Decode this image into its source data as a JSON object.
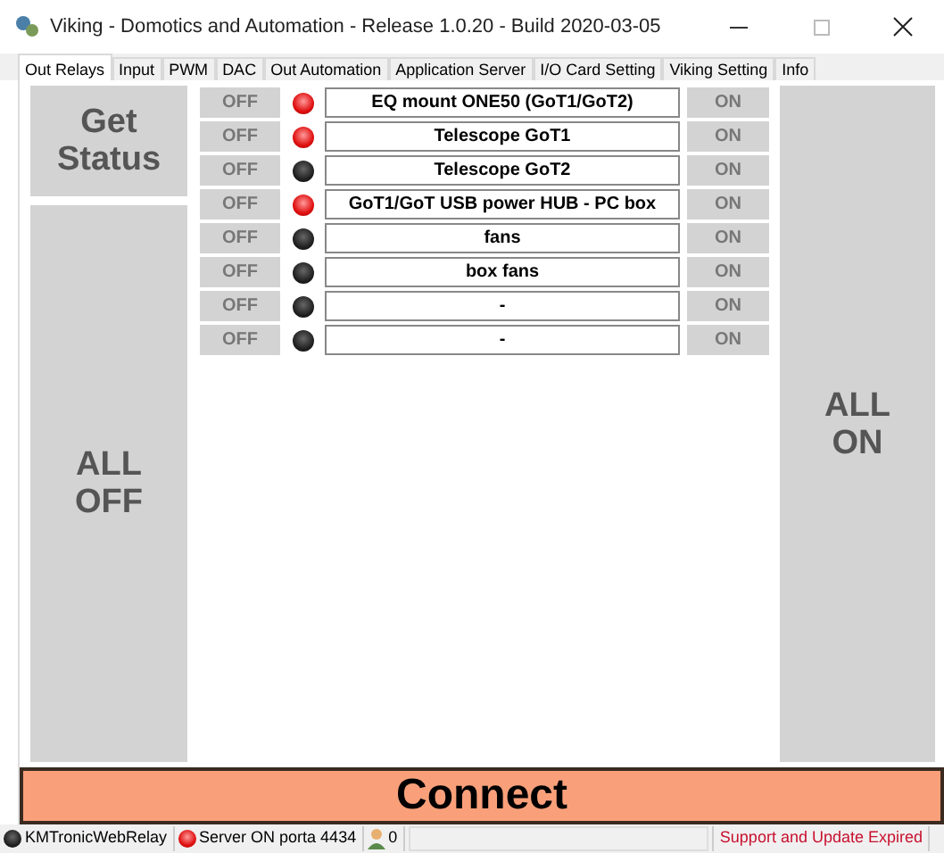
{
  "window": {
    "title": "Viking - Domotics and Automation - Release 1.0.20 - Build 2020-03-05"
  },
  "tabs": [
    {
      "label": "Out Relays",
      "selected": true
    },
    {
      "label": "Input",
      "selected": false
    },
    {
      "label": "PWM",
      "selected": false
    },
    {
      "label": "DAC",
      "selected": false
    },
    {
      "label": "Out Automation",
      "selected": false
    },
    {
      "label": "Application Server",
      "selected": false
    },
    {
      "label": "I/O Card Setting",
      "selected": false
    },
    {
      "label": "Viking Setting",
      "selected": false
    },
    {
      "label": "Info",
      "selected": false
    }
  ],
  "get_status_button": "Get Status",
  "all_off_button": "ALL OFF",
  "all_on_button": "ALL ON",
  "relays": [
    {
      "off": "OFF",
      "on_label": "ON",
      "name": "EQ mount ONE50 (GoT1/GoT2)",
      "on": true
    },
    {
      "off": "OFF",
      "on_label": "ON",
      "name": "Telescope GoT1",
      "on": true
    },
    {
      "off": "OFF",
      "on_label": "ON",
      "name": "Telescope GoT2",
      "on": false
    },
    {
      "off": "OFF",
      "on_label": "ON",
      "name": "GoT1/GoT USB power HUB - PC box",
      "on": true
    },
    {
      "off": "OFF",
      "on_label": "ON",
      "name": "fans",
      "on": false
    },
    {
      "off": "OFF",
      "on_label": "ON",
      "name": "box fans",
      "on": false
    },
    {
      "off": "OFF",
      "on_label": "ON",
      "name": "-",
      "on": false
    },
    {
      "off": "OFF",
      "on_label": "ON",
      "name": "-",
      "on": false
    }
  ],
  "connect_button": "Connect",
  "status_bar": {
    "relay_status": {
      "label": "KMTronicWebRelay",
      "on": false
    },
    "server": {
      "label": "Server ON porta 4434",
      "on": true
    },
    "users": "0",
    "support": "Support and Update Expired"
  }
}
